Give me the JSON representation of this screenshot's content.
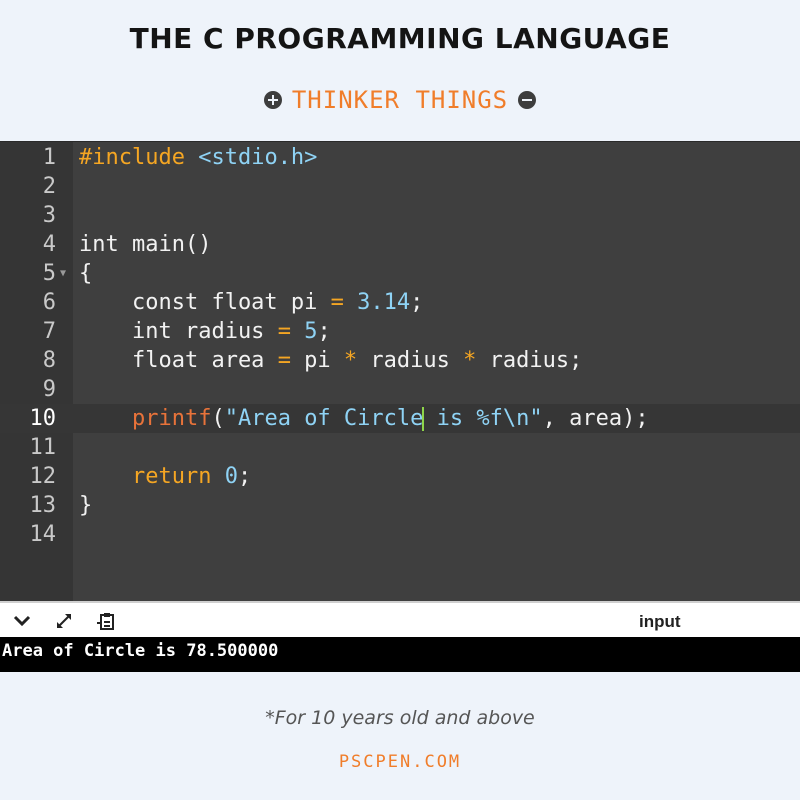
{
  "header": {
    "title": "THE C PROGRAMMING LANGUAGE",
    "brand": "THINKER THINGS",
    "left_icon": "plus-circle-icon",
    "right_icon": "minus-circle-icon"
  },
  "colors": {
    "accent": "#f07d2a",
    "editor_bg": "#3f3f3f",
    "gutter_bg": "#353535",
    "preprocessor": "#f5a623",
    "string": "#8fd3f5",
    "function": "#e8733a",
    "cursor": "#8ed44a",
    "console_bg": "#000000",
    "page_bg": "#eef3fa"
  },
  "editor": {
    "active_line": 10,
    "lines": [
      {
        "n": "1",
        "text": "#include <stdio.h>"
      },
      {
        "n": "2",
        "text": ""
      },
      {
        "n": "3",
        "text": ""
      },
      {
        "n": "4",
        "text": "int main()"
      },
      {
        "n": "5",
        "text": "{"
      },
      {
        "n": "6",
        "text": "    const float pi = 3.14;"
      },
      {
        "n": "7",
        "text": "    int radius = 5;"
      },
      {
        "n": "8",
        "text": "    float area = pi * radius * radius;"
      },
      {
        "n": "9",
        "text": ""
      },
      {
        "n": "10",
        "text": "    printf(\"Area of Circle is %f\\n\", area);"
      },
      {
        "n": "11",
        "text": ""
      },
      {
        "n": "12",
        "text": "    return 0;"
      },
      {
        "n": "13",
        "text": "}"
      },
      {
        "n": "14",
        "text": ""
      }
    ]
  },
  "toolbar": {
    "icons": [
      "chevron-down-icon",
      "expand-arrows-icon",
      "clipboard-icon"
    ],
    "input_label": "input"
  },
  "console": {
    "output": "Area of Circle is 78.500000"
  },
  "footer": {
    "note": "*For 10 years old and above",
    "site": "PSCPEN.COM"
  }
}
